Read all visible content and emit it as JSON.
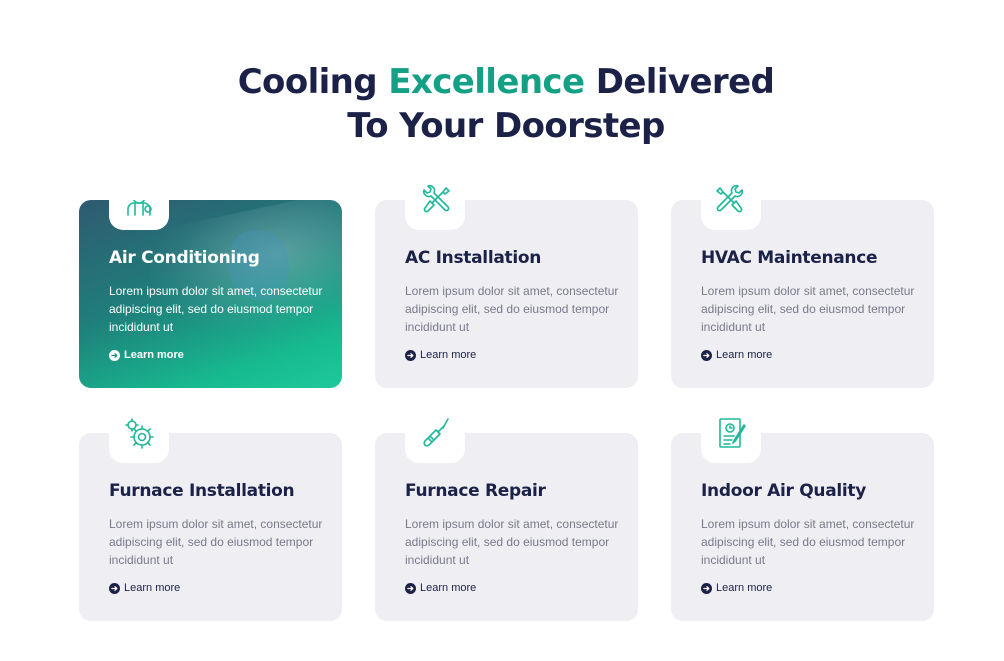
{
  "heading": {
    "line1_part1": "Cooling",
    "line1_accent": "Excellence",
    "line1_part2": "Delivered",
    "line2": "To Your Doorstep"
  },
  "colors": {
    "accent": "#14a085",
    "navy": "#1c2148",
    "card_bg": "#efeff3",
    "icon": "#1fb99a"
  },
  "services": [
    {
      "title": "Air Conditioning",
      "icon": "technician-icon",
      "desc": "Lorem ipsum dolor sit amet, consectetur adipiscing elit, sed do eiusmod tempor incididunt ut",
      "link": "Learn more",
      "active": true
    },
    {
      "title": "AC Installation",
      "icon": "wrench-screwdriver-icon",
      "desc": "Lorem ipsum dolor sit amet, consectetur adipiscing elit, sed do eiusmod tempor incididunt ut",
      "link": "Learn more"
    },
    {
      "title": "HVAC Maintenance",
      "icon": "wrench-screwdriver-icon",
      "desc": "Lorem ipsum dolor sit amet, consectetur adipiscing elit, sed do eiusmod tempor incididunt ut",
      "link": "Learn more"
    },
    {
      "title": "Furnace Installation",
      "icon": "gears-icon",
      "desc": "Lorem ipsum dolor sit amet, consectetur adipiscing elit, sed do eiusmod tempor incididunt ut",
      "link": "Learn more"
    },
    {
      "title": "Furnace Repair",
      "icon": "screwdriver-icon",
      "desc": "Lorem ipsum dolor sit amet, consectetur adipiscing elit, sed do eiusmod tempor incididunt ut",
      "link": "Learn more"
    },
    {
      "title": "Indoor Air Quality",
      "icon": "clipboard-report-icon",
      "desc": "Lorem ipsum dolor sit amet, consectetur adipiscing elit, sed do eiusmod tempor incididunt ut",
      "link": "Learn more"
    }
  ]
}
